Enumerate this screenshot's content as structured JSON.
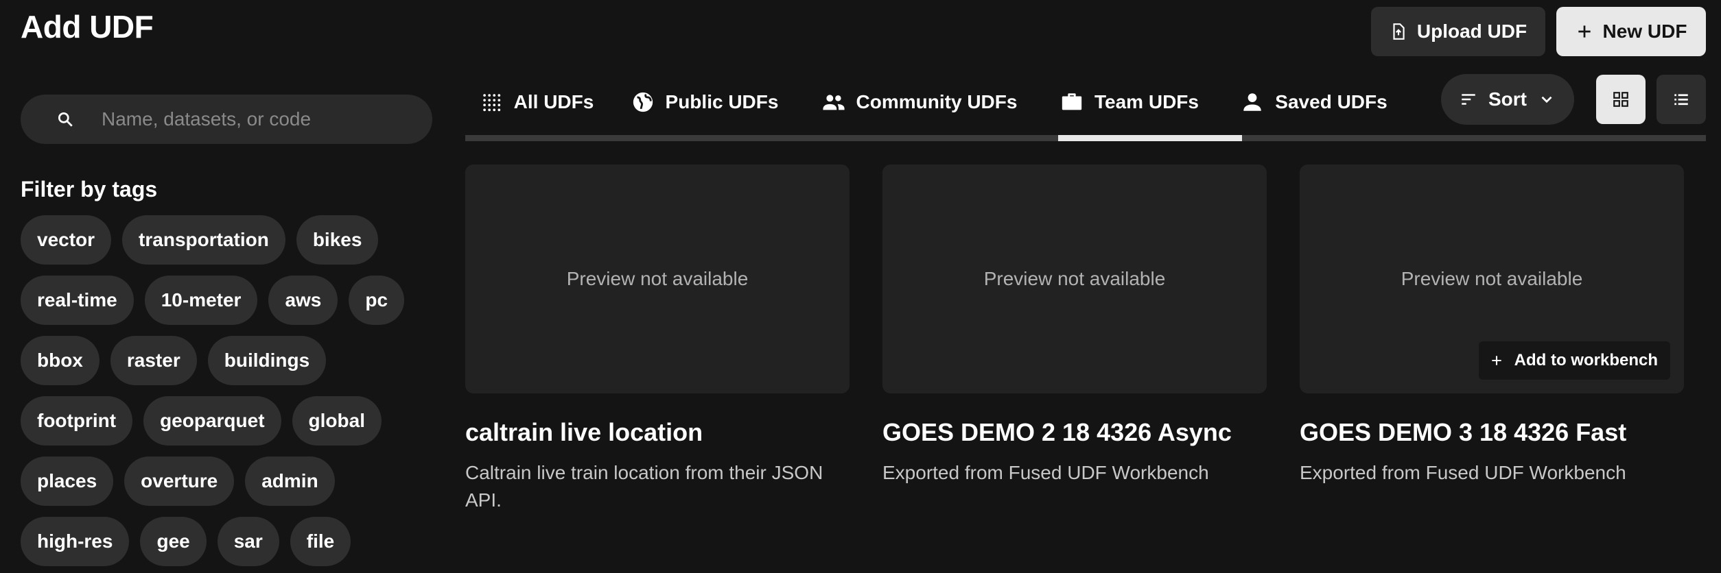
{
  "page": {
    "title": "Add UDF"
  },
  "actions": {
    "upload_label": "Upload UDF",
    "new_label": "New UDF"
  },
  "search": {
    "placeholder": "Name, datasets, or code",
    "value": ""
  },
  "filters": {
    "heading": "Filter by tags",
    "tags": [
      "vector",
      "transportation",
      "bikes",
      "real-time",
      "10-meter",
      "aws",
      "pc",
      "bbox",
      "raster",
      "buildings",
      "footprint",
      "geoparquet",
      "global",
      "places",
      "overture",
      "admin",
      "high-res",
      "gee",
      "sar",
      "file"
    ]
  },
  "tabs": [
    {
      "label": "All UDFs",
      "icon": "grid-dots-icon",
      "active": false
    },
    {
      "label": "Public UDFs",
      "icon": "globe-icon",
      "active": false
    },
    {
      "label": "Community UDFs",
      "icon": "people-icon",
      "active": false
    },
    {
      "label": "Team UDFs",
      "icon": "briefcase-icon",
      "active": true
    },
    {
      "label": "Saved UDFs",
      "icon": "person-icon",
      "active": false
    }
  ],
  "sort": {
    "label": "Sort"
  },
  "view": {
    "selected": "grid"
  },
  "cards": [
    {
      "title": "caltrain live location",
      "description": "Caltrain live train location from their JSON API.",
      "preview": "Preview not available"
    },
    {
      "title": "GOES DEMO 2 18 4326 Async",
      "description": "Exported from Fused UDF Workbench",
      "preview": "Preview not available"
    },
    {
      "title": "GOES DEMO 3 18 4326 Fast",
      "description": "Exported from Fused UDF Workbench",
      "preview": "Preview not available",
      "hover_action": "Add to workbench"
    }
  ],
  "colors": {
    "background": "#141414",
    "surface": "#2d2d2d",
    "accent": "#e8e8e8"
  }
}
